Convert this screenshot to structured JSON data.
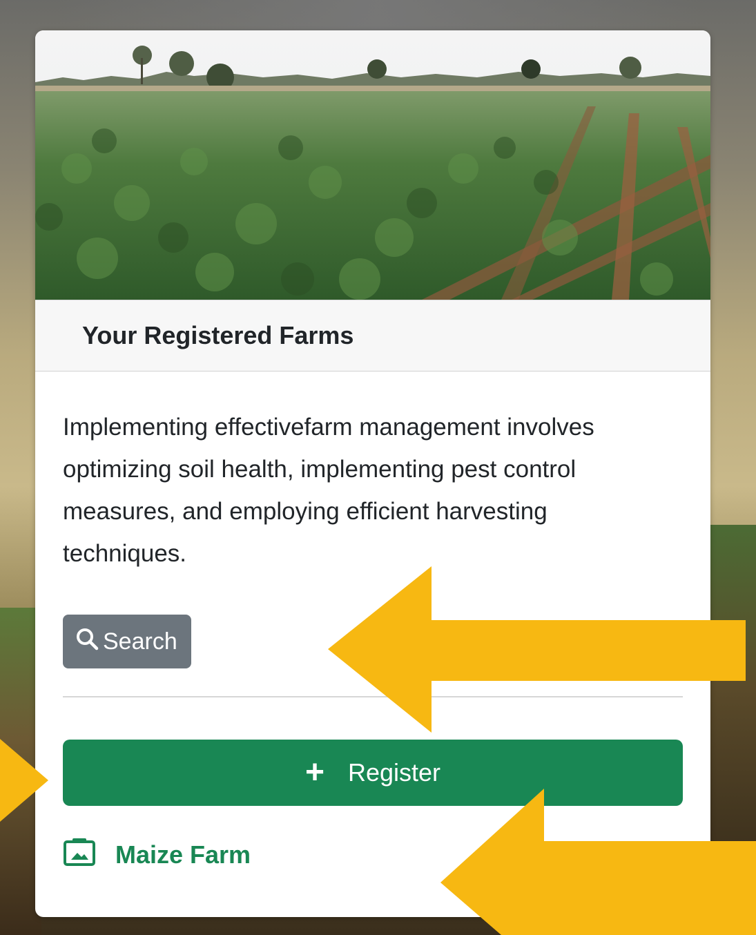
{
  "card": {
    "title": "Your Registered Farms",
    "description": "Implementing effectivefarm management involves optimizing soil health, implementing pest control measures, and employing efficient harvesting techniques.",
    "search_label": "Search",
    "register_label": "Register",
    "farms": [
      {
        "name": "Maize Farm",
        "icon": "image-icon"
      }
    ]
  },
  "icons": {
    "search": "search-icon",
    "register": "plus-icon",
    "farm": "image-icon"
  },
  "colors": {
    "search_button": "#6c757d",
    "register_button": "#198754",
    "farm_link": "#198754",
    "annotation_arrow": "#f7b812"
  }
}
